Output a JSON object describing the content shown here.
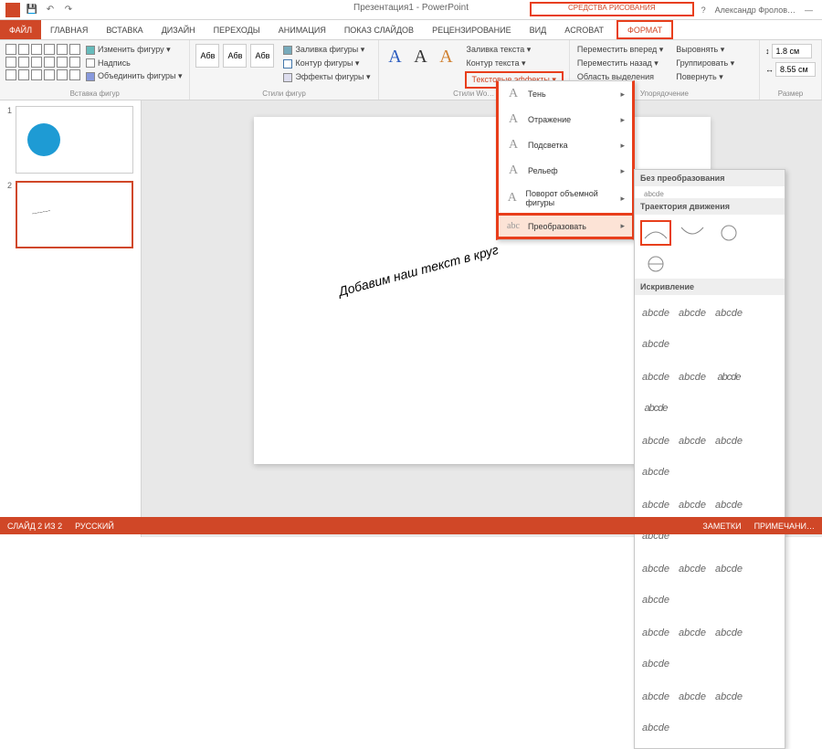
{
  "title": "Презентация1 - PowerPoint",
  "user": "Александр Фролов…",
  "tool_context": "СРЕДСТВА РИСОВАНИЯ",
  "tabs": {
    "file": "ФАЙЛ",
    "items": [
      "ГЛАВНАЯ",
      "ВСТАВКА",
      "ДИЗАЙН",
      "ПЕРЕХОДЫ",
      "АНИМАЦИЯ",
      "ПОКАЗ СЛАЙДОВ",
      "РЕЦЕНЗИРОВАНИЕ",
      "ВИД",
      "ACROBAT"
    ],
    "format": "ФОРМАТ"
  },
  "ribbon": {
    "shapes": {
      "edit_shape": "Изменить фигуру ▾",
      "textbox": "Надпись",
      "merge": "Объединить фигуры ▾",
      "label": "Вставка фигур"
    },
    "styles": {
      "sample": "Абв",
      "fill": "Заливка фигуры ▾",
      "outline": "Контур фигуры ▾",
      "effects": "Эффекты фигуры ▾",
      "label": "Стили фигур"
    },
    "wordart": {
      "fill": "Заливка текста ▾",
      "outline": "Контур текста ▾",
      "effects": "Текстовые эффекты ▾",
      "label": "Стили Wo…"
    },
    "arrange": {
      "forward": "Переместить вперед ▾",
      "backward": "Переместить назад ▾",
      "selection": "Область выделения",
      "align": "Выровнять ▾",
      "group": "Группировать ▾",
      "rotate": "Повернуть ▾",
      "label": "Упорядочение"
    },
    "size": {
      "h": "1.8 см",
      "w": "8.55 см",
      "label": "Размер"
    }
  },
  "menu": {
    "shadow": "Тень",
    "reflection": "Отражение",
    "glow": "Подсветка",
    "bevel": "Рельеф",
    "rotation3d": "Поворот объемной фигуры",
    "transform": "Преобразовать"
  },
  "transform": {
    "none": "Без преобразования",
    "none_sample": "abcde",
    "path": "Траектория движения",
    "warp": "Искривление",
    "samp": "abcde"
  },
  "slide": {
    "text": "Добавим наш текст в круг"
  },
  "status": {
    "slide": "СЛАЙД 2 ИЗ 2",
    "lang": "РУССКИЙ",
    "notes": "ЗАМЕТКИ",
    "comments": "ПРИМЕЧАНИ…"
  }
}
